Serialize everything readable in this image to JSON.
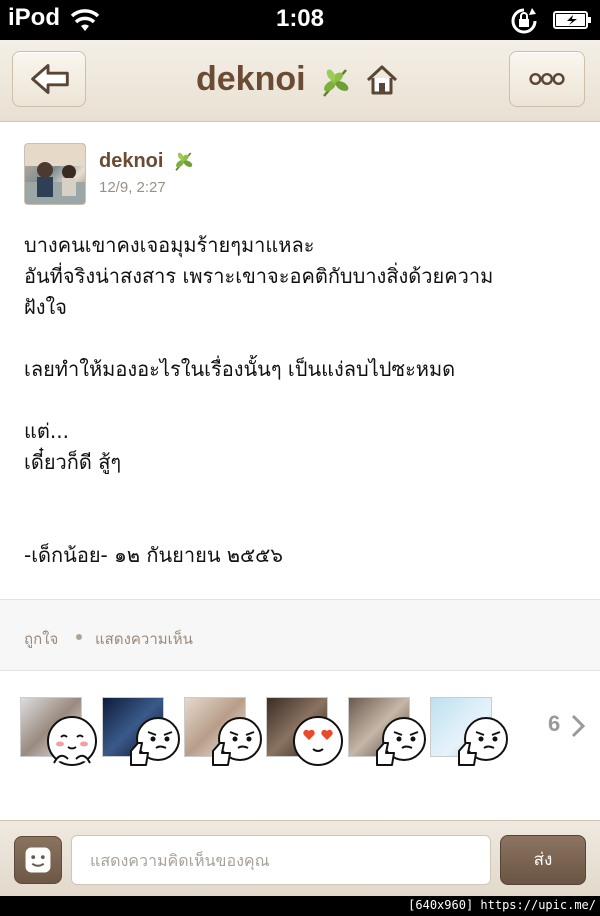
{
  "status_bar": {
    "carrier": "iPod",
    "time": "1:08"
  },
  "nav": {
    "title": "deknoi",
    "icons": [
      "back-arrow-icon",
      "leaf-icon",
      "home-icon",
      "more-dots-icon"
    ]
  },
  "post": {
    "author": "deknoi",
    "timestamp": "12/9, 2:27",
    "lines": [
      "บางคนเขาคงเจอมุมร้ายๆมาแหละ",
      "อันที่จริงน่าสงสาร เพราะเขาจะอคติกับบางสิ่งด้วยความ",
      "ฝังใจ",
      "",
      "เลยทำให้มองอะไรในเรื่องนั้นๆ เป็นแง่ลบไปซะหมด",
      "",
      "แต่...",
      "เดี๋ยวก็ดี สู้ๆ",
      "",
      "",
      "-เด็กน้อย-  ๑๒ กันยายน ๒๕๕๖"
    ]
  },
  "actions": {
    "like": "ถูกใจ",
    "comment": "แสดงความเห็น"
  },
  "likes": {
    "count": "6",
    "stickers": [
      "shy-face-sticker",
      "thumbs-up-sticker",
      "thumbs-up-sticker",
      "heart-eyes-sticker",
      "thumbs-up-sticker",
      "thumbs-up-sticker"
    ]
  },
  "comment_box": {
    "placeholder": "แสดงความคิดเห็นของคุณ",
    "send_label": "ส่ง"
  },
  "watermark": "[640x960] https://upic.me/",
  "colors": {
    "brown_text": "#6b4b33",
    "nav_bg": "#f4efe6",
    "send_bg": "#7a6352"
  }
}
